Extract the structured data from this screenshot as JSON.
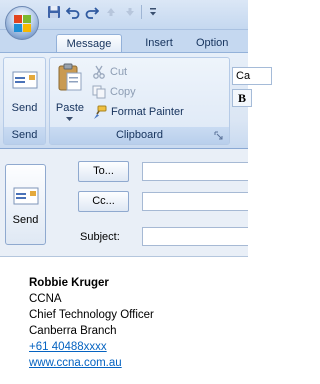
{
  "ribbon_tabs": [
    "Message",
    "Insert",
    "Option"
  ],
  "clipboard": {
    "send_label": "Send",
    "paste_label": "Paste",
    "cut_label": "Cut",
    "copy_label": "Copy",
    "format_painter_label": "Format Painter",
    "group_send": "Send",
    "group_clipboard": "Clipboard"
  },
  "font": {
    "name_value": "Ca",
    "bold_label": "B"
  },
  "compose": {
    "send_label": "Send",
    "to_label": "To...",
    "cc_label": "Cc...",
    "subject_label": "Subject:",
    "to_value": "",
    "cc_value": "",
    "subject_value": ""
  },
  "signature": {
    "name": "Robbie Kruger",
    "company": "CCNA",
    "title": "Chief Technology Officer",
    "branch": "Canberra Branch",
    "phone": "+61 40488xxxx",
    "website": "www.ccna.com.au"
  },
  "colors": {
    "link": "#0563c1",
    "ribbon_text": "#15325c"
  }
}
